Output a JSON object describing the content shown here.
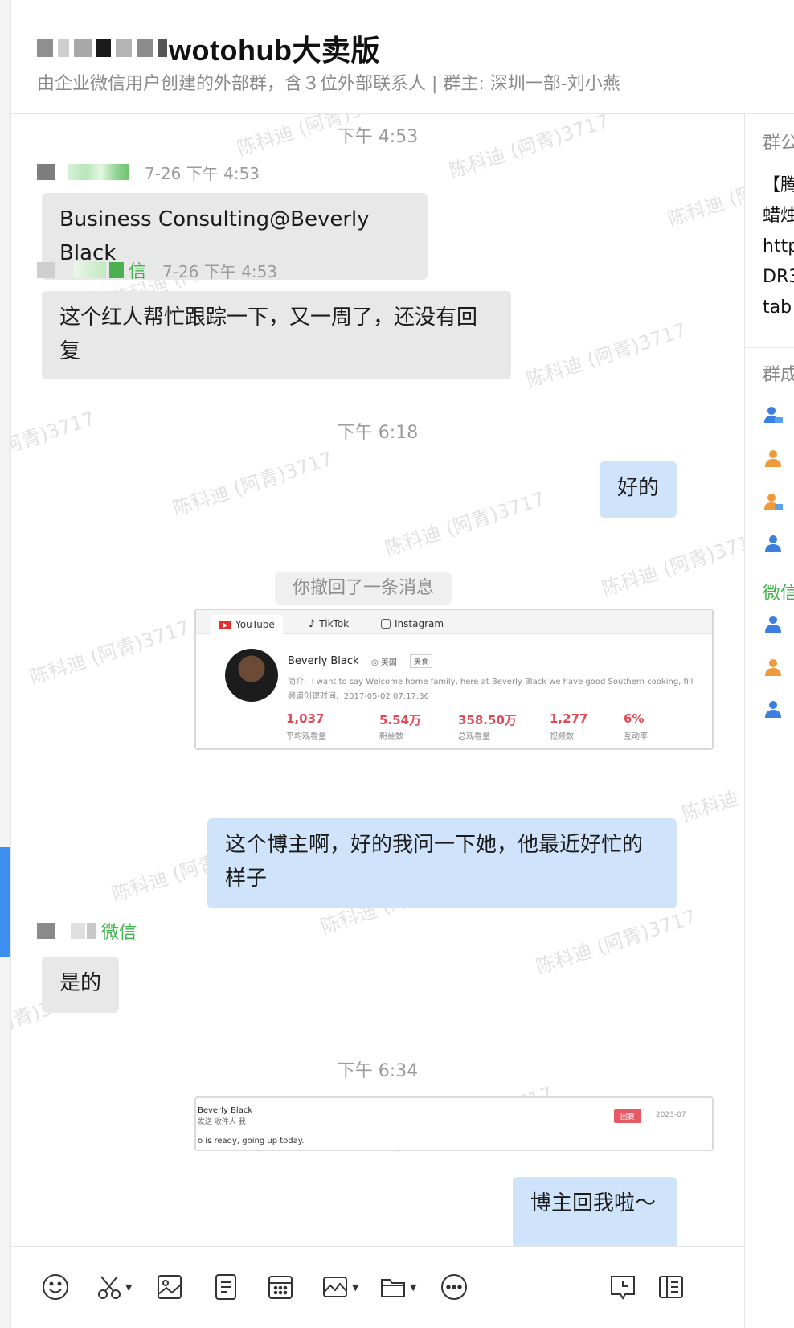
{
  "header": {
    "title": "wotohub大卖版",
    "subtitle": "由企业微信用户创建的外部群，含３位外部联系人 | 群主: 深圳一部-刘小燕"
  },
  "watermark": "陈科迪 (阿青)3717",
  "messages": {
    "time1": "下午 4:53",
    "sender1_meta": "7-26 下午 4:53",
    "msg1": "Business Consulting@Beverly Black",
    "sender2_wx": "信",
    "sender2_meta": "7-26 下午 4:53",
    "msg2_line1": "这个红人帮忙跟踪一下，又一周了，还没有回",
    "msg2_line2": "复",
    "time2": "下午 6:18",
    "msg3": "好的",
    "recall": "你撤回了一条消息",
    "msg4_line1": "这个博主啊，好的我问一下她，他最近好忙的",
    "msg4_line2": "样子",
    "sender3_wx": "微信",
    "msg5": "是的",
    "time3": "下午 6:34",
    "msg6": "博主回我啦～"
  },
  "card": {
    "tabs": [
      "YouTube",
      "TikTok",
      "Instagram"
    ],
    "name": "Beverly Black",
    "country": "美国",
    "tag": "美食",
    "desc_label": "简介:",
    "desc": "I want to say Welcome home family, here at Beverly Black we have good Southern cooking, fill",
    "date_label": "频道创建时间:",
    "date": "2017-05-02 07:17:36",
    "stats": [
      {
        "value": "1,037",
        "label": "平均观看量"
      },
      {
        "value": "5.54万",
        "label": "粉丝数"
      },
      {
        "value": "358.50万",
        "label": "总观看量"
      },
      {
        "value": "1,277",
        "label": "视频数"
      },
      {
        "value": "6%",
        "label": "互动率"
      }
    ]
  },
  "card2": {
    "name": "Beverly Black",
    "sub": "发送 收件人 我",
    "badge": "回复",
    "date": "2023-07",
    "text": "o is ready, going up today."
  },
  "right_panel": {
    "announce_label": "群公",
    "announce_lines": [
      "【腾",
      "蜡烛",
      "http",
      "DR3",
      "tab"
    ],
    "members_label": "群成",
    "wechat_label": "微信"
  },
  "colors": {
    "incoming_bubble": "#e8e8e8",
    "outgoing_bubble": "#cfe3fb",
    "wechat_green": "#3fb24b",
    "stat_red": "#e34a57",
    "member_blue": "#3b7fe0",
    "member_orange": "#f09a3a"
  }
}
